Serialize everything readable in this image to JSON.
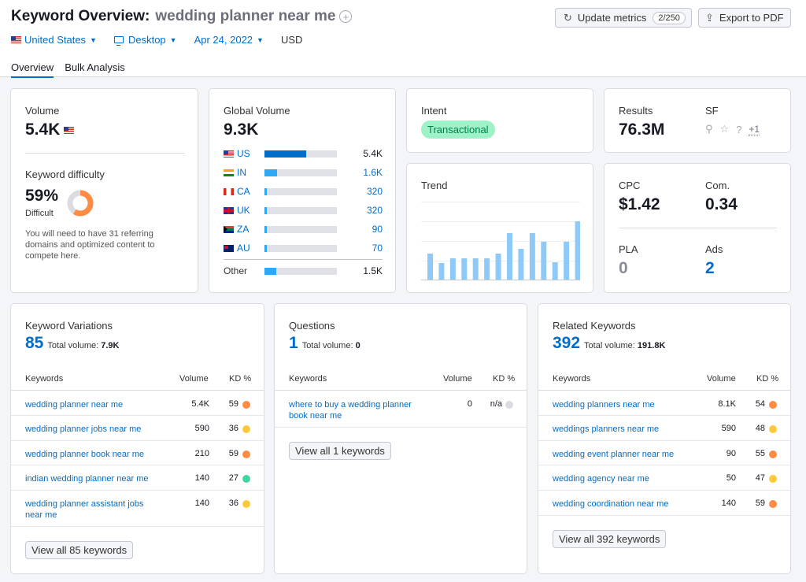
{
  "header": {
    "title": "Keyword Overview:",
    "keyword": "wedding planner near me",
    "update_label": "Update metrics",
    "update_count": "2/250",
    "export_label": "Export to PDF"
  },
  "filters": {
    "country": "United States",
    "device": "Desktop",
    "date": "Apr 24, 2022",
    "currency": "USD"
  },
  "tabs": [
    "Overview",
    "Bulk Analysis"
  ],
  "volume": {
    "label": "Volume",
    "value": "5.4K",
    "kd_label": "Keyword difficulty",
    "kd_value": "59%",
    "kd_fraction": 0.59,
    "kd_level": "Difficult",
    "kd_desc": "You will need to have 31 referring domains and optimized content to compete here."
  },
  "global_volume": {
    "label": "Global Volume",
    "value": "9.3K",
    "rows": [
      {
        "code": "US",
        "value": "5.4K",
        "share": 0.58,
        "flag": "us",
        "linked": false
      },
      {
        "code": "IN",
        "value": "1.6K",
        "share": 0.17,
        "flag": "in",
        "linked": true
      },
      {
        "code": "CA",
        "value": "320",
        "share": 0.034,
        "flag": "ca",
        "linked": true
      },
      {
        "code": "UK",
        "value": "320",
        "share": 0.034,
        "flag": "uk",
        "linked": true
      },
      {
        "code": "ZA",
        "value": "90",
        "share": 0.01,
        "flag": "za",
        "linked": true
      },
      {
        "code": "AU",
        "value": "70",
        "share": 0.008,
        "flag": "au",
        "linked": true
      }
    ],
    "other": {
      "code": "Other",
      "value": "1.5K",
      "share": 0.16
    }
  },
  "intent": {
    "label": "Intent",
    "value": "Transactional"
  },
  "trend": {
    "label": "Trend",
    "values": [
      0.34,
      0.22,
      0.28,
      0.28,
      0.28,
      0.28,
      0.34,
      0.6,
      0.4,
      0.6,
      0.49,
      0.23,
      0.49,
      0.75
    ]
  },
  "results": {
    "label": "Results",
    "value": "76.3M",
    "sf_label": "SF",
    "sf_more": "+1",
    "sf_icons": [
      "location-pin-icon",
      "star-icon",
      "question-icon"
    ]
  },
  "cpc": {
    "cpc_label": "CPC",
    "cpc_value": "$1.42",
    "com_label": "Com.",
    "com_value": "0.34",
    "pla_label": "PLA",
    "pla_value": "0",
    "ads_label": "Ads",
    "ads_value": "2"
  },
  "colors": {
    "accent": "#006dca",
    "bar_us": "#006dca",
    "bar_other": "#2ea8f4",
    "trend_bar": "#8fc9f7",
    "kd_hard": "#ff8c43",
    "kd_medium": "#ffc83d",
    "kd_easy": "#44d6a0",
    "kd_na": "#dadce2",
    "intent_bg": "#9ff2c8"
  },
  "columns": {
    "keywords": "Keywords",
    "volume": "Volume",
    "kd": "KD %"
  },
  "total_volume_label": "Total volume:",
  "variations": {
    "title": "Keyword Variations",
    "count": "85",
    "total": "7.9K",
    "view_all": "View all 85 keywords",
    "rows": [
      {
        "keyword": "wedding planner near me",
        "volume": "5.4K",
        "kd": "59",
        "level": "hard"
      },
      {
        "keyword": "wedding planner jobs near me",
        "volume": "590",
        "kd": "36",
        "level": "medium"
      },
      {
        "keyword": "wedding planner book near me",
        "volume": "210",
        "kd": "59",
        "level": "hard"
      },
      {
        "keyword": "indian wedding planner near me",
        "volume": "140",
        "kd": "27",
        "level": "easy"
      },
      {
        "keyword": "wedding planner assistant jobs near me",
        "volume": "140",
        "kd": "36",
        "level": "medium"
      }
    ]
  },
  "questions": {
    "title": "Questions",
    "count": "1",
    "total": "0",
    "view_all": "View all 1 keywords",
    "rows": [
      {
        "keyword": "where to buy a wedding planner book near me",
        "volume": "0",
        "kd": "n/a",
        "level": "na"
      }
    ]
  },
  "related": {
    "title": "Related Keywords",
    "count": "392",
    "total": "191.8K",
    "view_all": "View all 392 keywords",
    "rows": [
      {
        "keyword": "wedding planners near me",
        "volume": "8.1K",
        "kd": "54",
        "level": "hard"
      },
      {
        "keyword": "weddings planners near me",
        "volume": "590",
        "kd": "48",
        "level": "medium"
      },
      {
        "keyword": "wedding event planner near me",
        "volume": "90",
        "kd": "55",
        "level": "hard"
      },
      {
        "keyword": "wedding agency near me",
        "volume": "50",
        "kd": "47",
        "level": "medium"
      },
      {
        "keyword": "wedding coordination near me",
        "volume": "140",
        "kd": "59",
        "level": "hard"
      }
    ]
  }
}
